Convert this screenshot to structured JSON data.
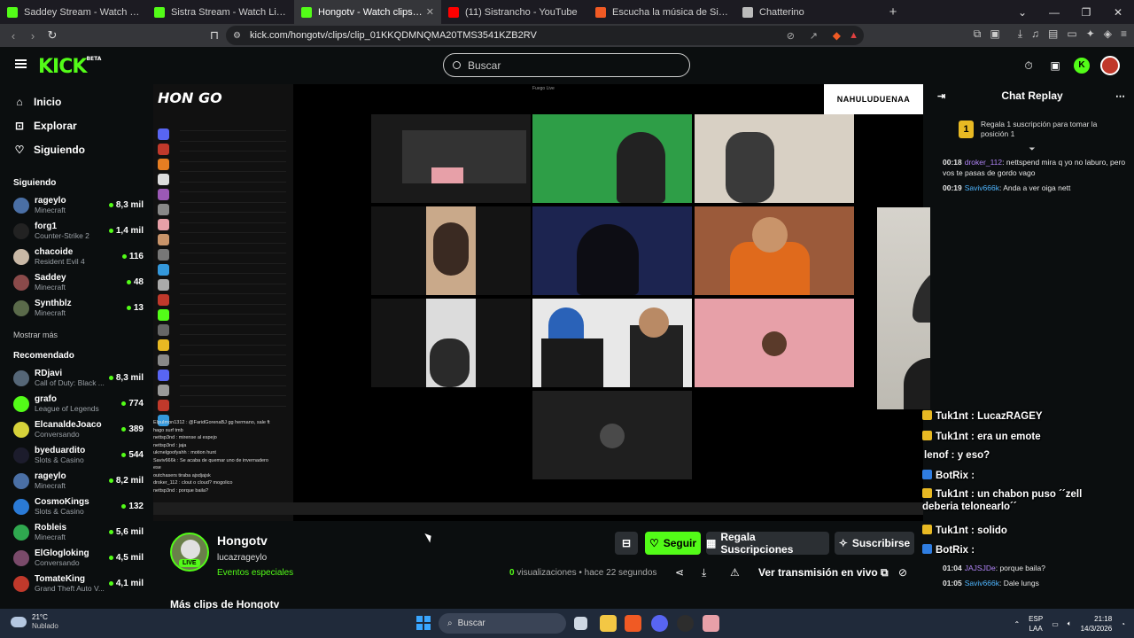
{
  "browser": {
    "tabs": [
      {
        "title": "Saddey Stream - Watch Live on K",
        "fav": "#53fc18",
        "active": false
      },
      {
        "title": "Sistra Stream - Watch Live on Kic",
        "fav": "#53fc18",
        "active": false
      },
      {
        "title": "Hongotv - Watch clips on Kic",
        "fav": "#53fc18",
        "active": true
      },
      {
        "title": "(11) Sistrancho - YouTube",
        "fav": "#ff0000",
        "active": false
      },
      {
        "title": "Escucha la música de Sistracks | Disfr",
        "fav": "#f15a24",
        "active": false
      },
      {
        "title": "Chatterino",
        "fav": "#bbbbbb",
        "active": false
      }
    ],
    "url": "kick.com/hongotv/clips/clip_01KKQDMNQMA20TMS3541KZB2RV"
  },
  "header": {
    "logo": "KICK",
    "logo_beta": "BETA",
    "search_placeholder": "Buscar"
  },
  "sidebar": {
    "nav": [
      {
        "label": "Inicio",
        "icon": "home-icon",
        "glyph": "⌂"
      },
      {
        "label": "Explorar",
        "icon": "compass-icon",
        "glyph": "⊡"
      },
      {
        "label": "Siguiendo",
        "icon": "heart-icon",
        "glyph": "♡"
      }
    ],
    "following_title": "Siguiendo",
    "following": [
      {
        "name": "rageylo",
        "game": "Minecraft",
        "viewers": "8,3 mil",
        "color": "#4a6fa5"
      },
      {
        "name": "forg1",
        "game": "Counter-Strike 2",
        "viewers": "1,4 mil",
        "color": "#222222"
      },
      {
        "name": "chacoide",
        "game": "Resident Evil 4",
        "viewers": "116",
        "color": "#c9b8a6"
      },
      {
        "name": "Saddey",
        "game": "Minecraft",
        "viewers": "48",
        "color": "#8a4a4a"
      },
      {
        "name": "Synthblz",
        "game": "Minecraft",
        "viewers": "13",
        "color": "#5a6a4a"
      }
    ],
    "show_more": "Mostrar más",
    "recommended_title": "Recomendado",
    "recommended": [
      {
        "name": "RDjavi",
        "game": "Call of Duty: Black ...",
        "viewers": "8,3 mil",
        "color": "#556677"
      },
      {
        "name": "grafo",
        "game": "League of Legends",
        "viewers": "774",
        "color": "#53fc18"
      },
      {
        "name": "ElcanaldeJoaco",
        "game": "Conversando",
        "viewers": "389",
        "color": "#d6d23a"
      },
      {
        "name": "byeduardito",
        "game": "Slots & Casino",
        "viewers": "544",
        "color": "#1c1c2c"
      },
      {
        "name": "rageylo",
        "game": "Minecraft",
        "viewers": "8,2 mil",
        "color": "#4a6fa5"
      },
      {
        "name": "CosmoKings",
        "game": "Slots & Casino",
        "viewers": "132",
        "color": "#2a7ad6"
      },
      {
        "name": "Robleis",
        "game": "Minecraft",
        "viewers": "5,6 mil",
        "color": "#2fa84f"
      },
      {
        "name": "ElGlogloking",
        "game": "Conversando",
        "viewers": "4,5 mil",
        "color": "#7a4a6a"
      },
      {
        "name": "TomateKing",
        "game": "Grand Theft Auto V...",
        "viewers": "4,1 mil",
        "color": "#c0392b"
      }
    ]
  },
  "video": {
    "brand_box": "NAHULUDUENAA",
    "hongo_logo": "HON GO",
    "top_label": "Fuego Live",
    "overlay_lines": [
      "ElpuImon1312 : @FaridGorenaBJ gg hermano, sale ft",
      "hago surf tmb",
      "nettsp3nd : mirense al espejo",
      "nettsp3nd : jaja",
      "ukrnelgoofyahh : motion hunt",
      "Saviv666k : Se acaba de quemar uno de invernadero",
      "ese",
      "outchasers tiraba ajsdjajsk",
      "droker_112 : clout o cloud? mogolico",
      "nettsp3nd : porque baila?"
    ]
  },
  "channel": {
    "name": "Hongotv",
    "sub": "lucazrageylo",
    "category": "Eventos especiales",
    "live_badge": "LIVE",
    "follow": "Seguir",
    "gift": "Regala Suscripciones",
    "subscribe": "Suscribirse",
    "views_count": "0",
    "views_label": "visualizaciones",
    "time_ago": "hace 22 segundos",
    "live_link": "Ver transmisión en vivo",
    "more_clips": "Más clips de Hongotv"
  },
  "chat": {
    "title": "Chat Replay",
    "gift_text": "Regala 1 suscripción para tomar la posición 1",
    "gift_rank": "1",
    "messages": [
      {
        "time": "00:18",
        "user": "droker_112",
        "color": "#b084f6",
        "text": "nettspend mira q yo no laburo, pero vos te pasas de gordo vago"
      },
      {
        "time": "00:19",
        "user": "Saviv666k",
        "color": "#4fb6ff",
        "text": "Anda a ver oiga nett"
      },
      {
        "time": "01:04",
        "user": "JAJSJDe",
        "color": "#b084f6",
        "text": "porque baila?"
      },
      {
        "time": "01:05",
        "user": "Saviv666k",
        "color": "#4fb6ff",
        "text": "Dale lungs"
      }
    ],
    "overlay": [
      {
        "user": "Tuk1nt",
        "text": "LucazRAGEY",
        "badge": "gold"
      },
      {
        "user": "Tuk1nt",
        "text": "era un emote",
        "badge": "gold"
      },
      {
        "user": "lenof",
        "text": "y eso?",
        "badge": "none"
      },
      {
        "user": "BotRix",
        "text": "",
        "badge": "blue"
      },
      {
        "user": "Tuk1nt",
        "text": "un chabon puso ´´zell deberia telonearlo´´",
        "badge": "gold"
      },
      {
        "user": "Tuk1nt",
        "text": "solido",
        "badge": "gold"
      },
      {
        "user": "BotRix",
        "text": "",
        "badge": "blue"
      }
    ]
  },
  "taskbar": {
    "temp": "21°C",
    "weather": "Nublado",
    "search": "Buscar",
    "lang1": "ESP",
    "lang2": "LAA",
    "time": "21:18",
    "date": "14/3/2026"
  }
}
